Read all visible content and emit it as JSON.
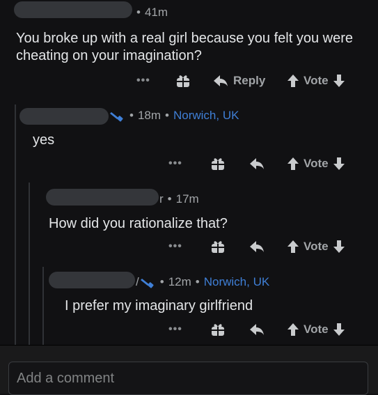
{
  "comments": [
    {
      "time": "41m",
      "body": "You broke up with a real girl because you felt you were cheating on your imagination?",
      "reply_label": "Reply",
      "vote_label": "Vote"
    },
    {
      "time": "18m",
      "location": "Norwich, UK",
      "body": "yes",
      "vote_label": "Vote"
    },
    {
      "username_tail": "r",
      "time": "17m",
      "body": "How did you rationalize that?",
      "vote_label": "Vote"
    },
    {
      "username_tail": "/",
      "time": "12m",
      "location": "Norwich, UK",
      "body": "I prefer my imaginary girlfriend",
      "vote_label": "Vote"
    }
  ],
  "footer": {
    "comment_placeholder": "Add a comment"
  },
  "icons": {
    "more": "more-options-icon",
    "award": "gift-icon",
    "reply": "reply-arrow-icon",
    "upvote": "upvote-arrow-icon",
    "downvote": "downvote-arrow-icon",
    "flair": "spray-paint-icon"
  },
  "colors": {
    "background": "#111113",
    "location_link": "#3f7fd6",
    "meta_text": "#a2a5a8"
  },
  "more_glyph": "•••"
}
